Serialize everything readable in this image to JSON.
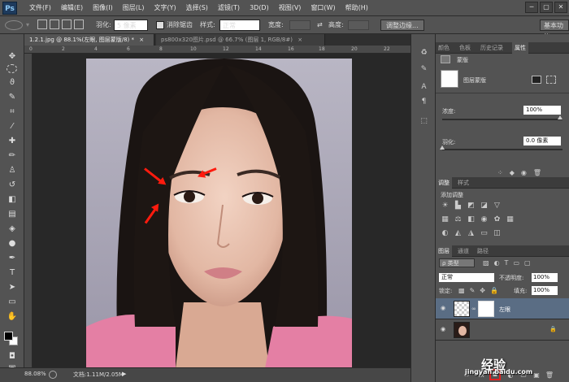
{
  "app": {
    "logo": "Ps",
    "menus": [
      "文件(F)",
      "编辑(E)",
      "图像(I)",
      "图层(L)",
      "文字(Y)",
      "选择(S)",
      "滤镜(T)",
      "3D(D)",
      "视图(V)",
      "窗口(W)",
      "帮助(H)"
    ],
    "win_controls": [
      "─",
      "▢",
      "✕"
    ]
  },
  "options": {
    "feather_label": "羽化:",
    "feather_value": "5 像素",
    "antialias_label": "消除锯齿",
    "style_label": "样式:",
    "style_value": "正常",
    "width_label": "宽度:",
    "height_label": "高度:",
    "refine_button": "调整边缘...",
    "workspace": "基本功能"
  },
  "doc_tabs": [
    {
      "label": "1.2.1.jpg @ 88.1%(左眼, 图层蒙版/8) *",
      "close": "×"
    },
    {
      "label": "ps800x320图片.psd @ 66.7% (图层 1, RGB/8#)",
      "close": "×"
    }
  ],
  "ruler_ticks": [
    "0",
    "2",
    "4",
    "6",
    "8",
    "10",
    "12",
    "14",
    "16",
    "18",
    "20",
    "22"
  ],
  "status": {
    "zoom": "88.08%",
    "doc": "文档:1.11M/2.05M"
  },
  "properties_panel": {
    "tabs": [
      "颜色",
      "色板",
      "历史记录",
      "属性"
    ],
    "mask_label": "蒙版",
    "layer_mask_label": "图层蒙版",
    "density_label": "浓度:",
    "density_value": "100%",
    "feather_label": "羽化:",
    "feather_value": "0.0 像素"
  },
  "adjust_panel": {
    "tabs": [
      "调整",
      "样式"
    ],
    "add_label": "添加调整"
  },
  "layers_panel": {
    "tabs": [
      "图层",
      "通道",
      "路径"
    ],
    "kind_label": "ρ 类型",
    "blend_mode": "正常",
    "opacity_label": "不透明度:",
    "opacity_value": "100%",
    "lock_label": "锁定:",
    "fill_label": "填充:",
    "fill_value": "100%",
    "layers": [
      {
        "name": "左眼",
        "visible": true,
        "selected": true
      },
      {
        "name": "",
        "visible": true,
        "selected": false
      }
    ]
  },
  "watermark": {
    "brand": "经验",
    "url": "jingyan.baidu.com"
  },
  "colors": {
    "accent_arrow": "#ff1b0e",
    "highlight_box": "#e02020",
    "layer_selected": "#5a6d84"
  }
}
